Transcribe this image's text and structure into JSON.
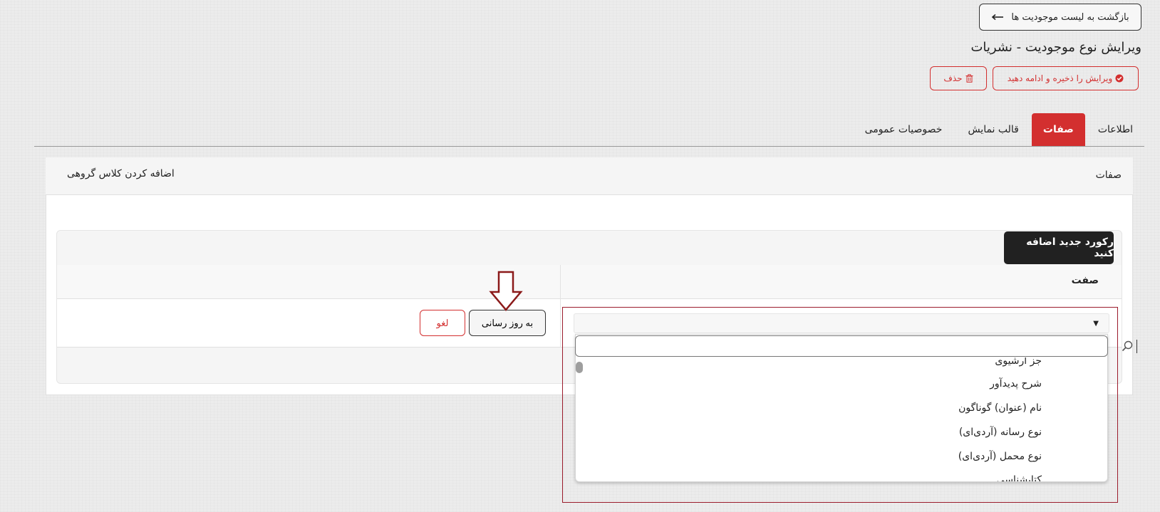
{
  "header": {
    "back_label": "بازگشت به لیست موجودیت ها",
    "title": "ویرایش نوع موجودیت - نشریات",
    "save_continue_label": "ویرایش را ذخیره و ادامه دهید",
    "delete_label": "حذف"
  },
  "tabs": [
    {
      "label": "اطلاعات"
    },
    {
      "label": "صفات",
      "active": true
    },
    {
      "label": "قالب نمایش"
    },
    {
      "label": "خصوصیات عمومی"
    }
  ],
  "panel": {
    "title": "صفات",
    "add_group_class_label": "اضافه کردن کلاس گروهی"
  },
  "editor": {
    "new_record_label": "رکورد جدید اضافه کنید",
    "column_attribute": "صفت",
    "update_label": "به روز رسانی",
    "cancel_label": "لغو"
  },
  "dropdown": {
    "search_value": "",
    "options": [
      "جز آرشیوی",
      "شرح پدیدآور",
      "نام (عنوان) گوناگون",
      "نوع رسانه (آردی‌ای)",
      "نوع محمل (آردی‌ای)",
      "کتابشناسی"
    ]
  },
  "colors": {
    "accent_red": "#d32f2f",
    "highlight_border": "#9b1c2c",
    "dark_button": "#212121",
    "arrow": "#8b1a1a"
  }
}
